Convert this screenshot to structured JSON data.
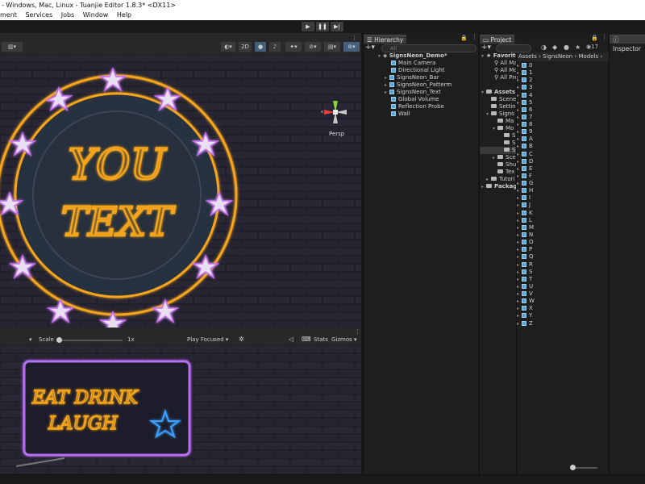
{
  "window": {
    "title": "- Windows, Mac, Linux - Tuanjie Editor 1.8.3* <DX11>"
  },
  "menu": [
    "ment",
    "Services",
    "Jobs",
    "Window",
    "Help"
  ],
  "play": {
    "play": "▶",
    "pause": "❚❚",
    "step": "▶|"
  },
  "scene": {
    "btn_2d": "2D",
    "persp_label": "Persp",
    "sign_line1": "YOU",
    "sign_line2": "TEXT"
  },
  "game": {
    "scale_label": "Scale",
    "scale_value": "1x",
    "play_focused": "Play Focused",
    "stats": "Stats",
    "gizmos": "Gizmos",
    "sign_line1": "EAT DRINK",
    "sign_line2": "LAUGH"
  },
  "hierarchy": {
    "tab": "Hierarchy",
    "search_placeholder": "All",
    "root": "SignsNeon_Demo*",
    "items": [
      "Main Camera",
      "Directional Light",
      "SignsNeon_Bar",
      "SignsNeon_Patterm",
      "SignsNeon_Text",
      "Global Volume",
      "Reflection Probe",
      "Wall"
    ]
  },
  "project": {
    "tab": "Project",
    "count": "17",
    "favorites": "Favorite",
    "fav_items": [
      "All Ma",
      "All Mo",
      "All Pre"
    ],
    "assets": "Assets",
    "tree": [
      "Scene",
      "Settin",
      "Signs",
      "Ma",
      "Mo",
      "S",
      "S",
      "S",
      "Sce",
      "Shu",
      "Tex",
      "Tutori"
    ],
    "packages": "Packag",
    "breadcrumb": [
      "Assets",
      "SignsNeon",
      "Models"
    ],
    "models": [
      "0",
      "1",
      "2",
      "3",
      "4",
      "5",
      "6",
      "7",
      "8",
      "9",
      "A",
      "B",
      "C",
      "D",
      "E",
      "F",
      "G",
      "H",
      "I",
      "J",
      "K",
      "L",
      "M",
      "N",
      "O",
      "P",
      "Q",
      "R",
      "S",
      "T",
      "U",
      "V",
      "W",
      "X",
      "Y",
      "Z"
    ]
  },
  "inspector": {
    "tab": "Inspector"
  }
}
